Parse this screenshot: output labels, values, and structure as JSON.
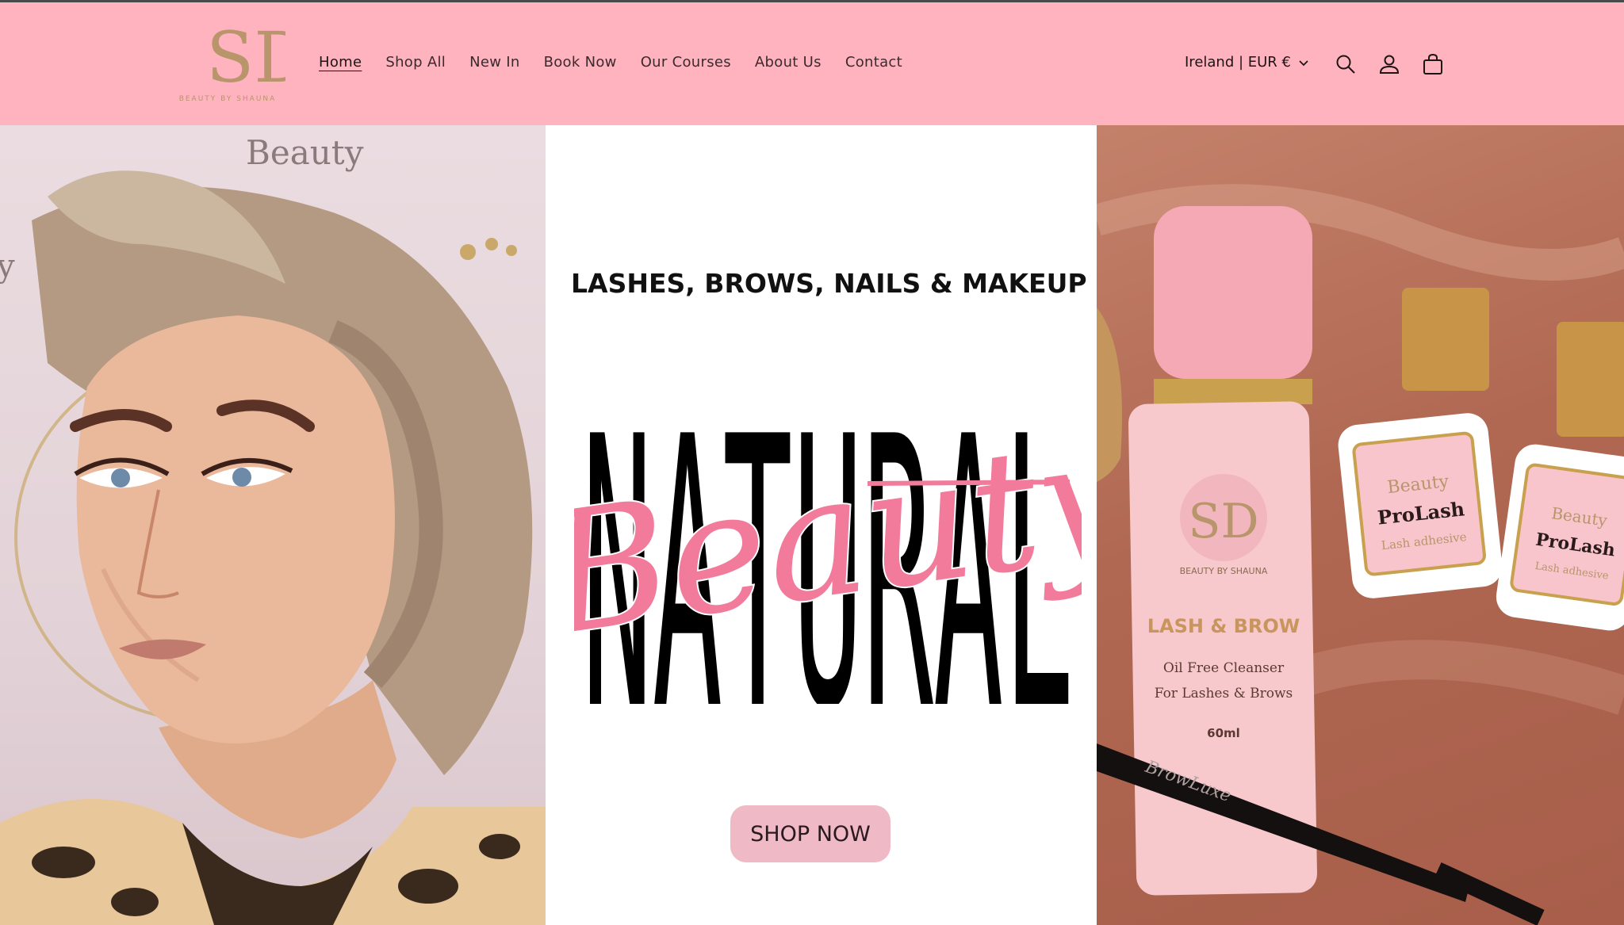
{
  "brand": {
    "logo_monogram": "SD",
    "logo_text": "BEAUTY BY SHAUNA",
    "accent": "#ffb3bf",
    "gold": "#b8956a",
    "pink": "#f27b9c"
  },
  "nav": {
    "items": [
      {
        "label": "Home",
        "active": true
      },
      {
        "label": "Shop All"
      },
      {
        "label": "New In"
      },
      {
        "label": "Book Now"
      },
      {
        "label": "Our Courses"
      },
      {
        "label": "About Us"
      },
      {
        "label": "Contact"
      }
    ]
  },
  "header": {
    "currency": "Ireland | EUR €",
    "icons": [
      "search-icon",
      "account-icon",
      "cart-icon"
    ]
  },
  "hero": {
    "left_backdrop_text": "Beauty",
    "left_backdrop_letter": "y",
    "tagline": "LASHES, BROWS, NAILS & MAKEUP",
    "headline": "NATURAL",
    "script_word": "Beauty",
    "cta_label": "SHOP NOW",
    "product": {
      "logo": "SD",
      "brand_line": "BEAUTY BY SHAUNA",
      "name": "LASH & BROW",
      "line1": "Oil Free Cleanser",
      "line2": "For Lashes & Brows",
      "volume": "60ml",
      "adhesive_word": "Beauty",
      "adhesive_name": "ProLash",
      "adhesive_sub": "Lash adhesive",
      "brush": "BrowLuxe"
    }
  }
}
